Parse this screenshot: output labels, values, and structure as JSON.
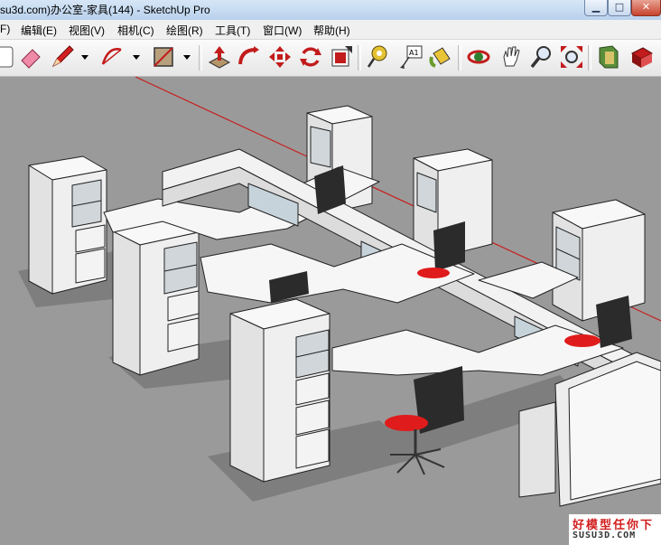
{
  "window": {
    "title": "su3d.com)办公室-家具(144) - SketchUp Pro",
    "min_glyph": "▁",
    "max_glyph": "□",
    "close_glyph": "✕"
  },
  "menu": {
    "items": [
      "F)",
      "编辑(E)",
      "视图(V)",
      "相机(C)",
      "绘图(R)",
      "工具(T)",
      "窗口(W)",
      "帮助(H)"
    ]
  },
  "toolbar": {
    "icons": [
      "select-icon",
      "eraser-icon",
      "pencil-icon",
      "arc-icon",
      "rectangle-icon",
      "push-pull-icon",
      "follow-me-icon",
      "move-icon",
      "rotate-icon",
      "offset-icon",
      "tape-measure-icon",
      "text-label-icon",
      "paint-bucket-icon",
      "orbit-icon",
      "pan-icon",
      "zoom-icon",
      "zoom-extents-icon",
      "components-icon",
      "sketchup-icon"
    ],
    "text_tool_label": "A1"
  },
  "watermark": {
    "line1": "好模型任你下",
    "line2": "SUSU3D.COM"
  },
  "colors": {
    "background": "#9a9a9a",
    "furniture": "#ececec",
    "chair_seat": "#e01b1b",
    "axis_red": "#c81e1e"
  }
}
